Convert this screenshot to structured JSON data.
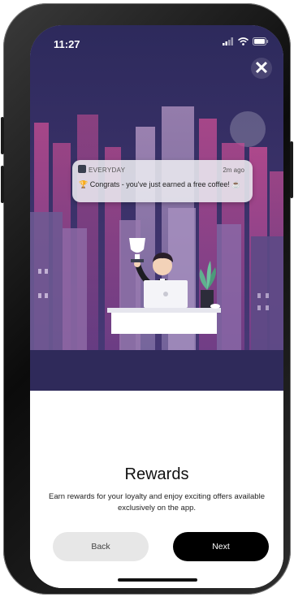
{
  "status": {
    "time": "11:27"
  },
  "notification": {
    "app": "EVERYDAY",
    "time": "2m ago",
    "message": "Congrats - you've just earned a free coffee!"
  },
  "onboarding": {
    "title": "Rewards",
    "description": "Earn rewards for your loyalty and enjoy exciting offers available exclusively on the app.",
    "back_label": "Back",
    "next_label": "Next"
  },
  "colors": {
    "hero_background": "#2f2a5a",
    "city_pink": "#b44b8e",
    "next_button": "#000000",
    "back_button": "#e7e7e7"
  }
}
